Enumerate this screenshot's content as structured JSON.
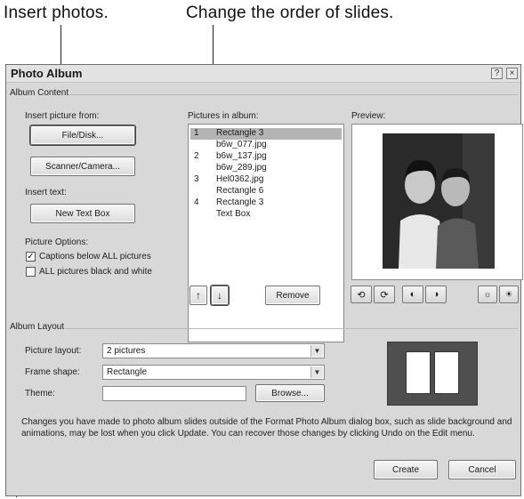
{
  "callouts": {
    "insert_photos": "Insert photos.",
    "change_order": "Change the order of slides."
  },
  "dialog": {
    "title": "Photo Album",
    "help_icon": "?",
    "close_icon": "×"
  },
  "album_content": {
    "group_label": "Album Content",
    "insert_from_label": "Insert picture from:",
    "file_disk_button": "File/Disk...",
    "scanner_button": "Scanner/Camera...",
    "insert_text_label": "Insert text:",
    "new_textbox_button": "New Text Box",
    "picture_options_label": "Picture Options:",
    "captions_option": "Captions below ALL pictures",
    "captions_checked": true,
    "bw_option": "ALL pictures black and white",
    "bw_checked": false
  },
  "pictures": {
    "label": "Pictures in album:",
    "items": [
      {
        "num": "1",
        "name": "Rectangle 3",
        "selected": true
      },
      {
        "num": "",
        "name": "b6w_077.jpg",
        "selected": false
      },
      {
        "num": "2",
        "name": "b6w_137.jpg",
        "selected": false
      },
      {
        "num": "",
        "name": "b6w_289.jpg",
        "selected": false
      },
      {
        "num": "3",
        "name": "Hel0362.jpg",
        "selected": false
      },
      {
        "num": "",
        "name": "Rectangle 6",
        "selected": false
      },
      {
        "num": "4",
        "name": "Rectangle 3",
        "selected": false
      },
      {
        "num": "",
        "name": "Text Box",
        "selected": false
      }
    ],
    "move_up_icon": "↑",
    "move_down_icon": "↓",
    "remove_button": "Remove"
  },
  "preview": {
    "label": "Preview:",
    "tools": [
      "rotate-left-icon",
      "rotate-right-icon",
      "contrast-up-icon",
      "contrast-down-icon",
      "brightness-up-icon",
      "brightness-down-icon"
    ]
  },
  "album_layout": {
    "group_label": "Album Layout",
    "picture_layout_label": "Picture layout:",
    "picture_layout_value": "2 pictures",
    "frame_shape_label": "Frame shape:",
    "frame_shape_value": "Rectangle",
    "theme_label": "Theme:",
    "theme_value": "",
    "browse_button": "Browse..."
  },
  "note": "Changes you have made to photo album slides outside of the Format Photo Album dialog box, such as slide background and animations, may be lost when you click Update. You can recover those changes by clicking Undo on the Edit menu.",
  "actions": {
    "create_button": "Create",
    "cancel_button": "Cancel"
  },
  "colors": {
    "dialog_bg": "#d8d8d8",
    "selection": "#b4b4b4",
    "layout_preview_bg": "#4f4f4f"
  }
}
